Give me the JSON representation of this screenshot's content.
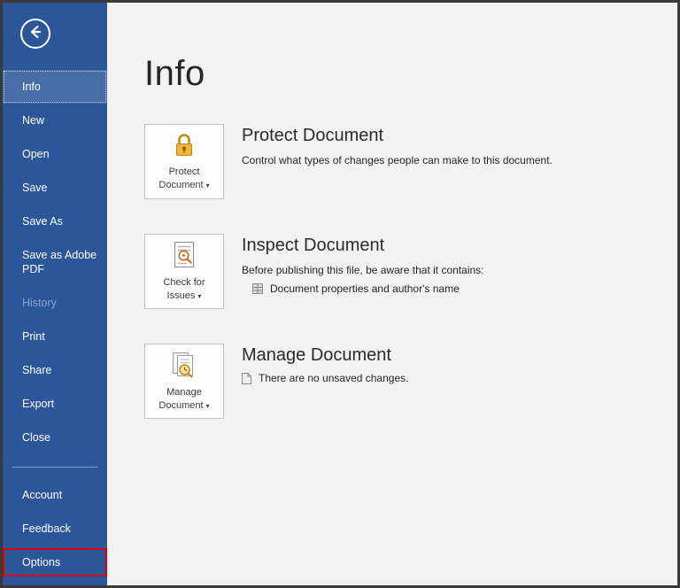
{
  "colors": {
    "sidebar_bg": "#2b579a",
    "content_bg": "#f2f2f2",
    "frame_border": "#3a3a3a",
    "annotation_red": "#e00000",
    "lock_gold": "#f2b632",
    "tile_border": "#c3c1bf"
  },
  "sidebar": {
    "back_icon": "back-arrow-icon",
    "items": [
      {
        "label": "Info",
        "state": "selected"
      },
      {
        "label": "New",
        "state": "normal"
      },
      {
        "label": "Open",
        "state": "normal"
      },
      {
        "label": "Save",
        "state": "normal"
      },
      {
        "label": "Save As",
        "state": "normal"
      },
      {
        "label": "Save as Adobe PDF",
        "state": "normal"
      },
      {
        "label": "History",
        "state": "disabled"
      },
      {
        "label": "Print",
        "state": "normal"
      },
      {
        "label": "Share",
        "state": "normal"
      },
      {
        "label": "Export",
        "state": "normal"
      },
      {
        "label": "Close",
        "state": "normal"
      }
    ],
    "bottom_items": [
      {
        "label": "Account",
        "state": "normal"
      },
      {
        "label": "Feedback",
        "state": "normal"
      },
      {
        "label": "Options",
        "state": "annotated-red-box"
      }
    ]
  },
  "main": {
    "title": "Info",
    "dropdown_glyph": "▾",
    "sections": [
      {
        "icon": "lock-icon",
        "button_line1": "Protect",
        "button_line2": "Document",
        "heading": "Protect Document",
        "description": "Control what types of changes people can make to this document."
      },
      {
        "icon": "inspect-document-icon",
        "button_line1": "Check for",
        "button_line2": "Issues",
        "heading": "Inspect Document",
        "description": "Before publishing this file, be aware that it contains:",
        "bullet_icon": "properties-icon",
        "bullet": "Document properties and author's name"
      },
      {
        "icon": "manage-document-icon",
        "button_line1": "Manage",
        "button_line2": "Document",
        "heading": "Manage Document",
        "bullet_icon": "document-icon",
        "bullet": "There are no unsaved changes."
      }
    ]
  }
}
